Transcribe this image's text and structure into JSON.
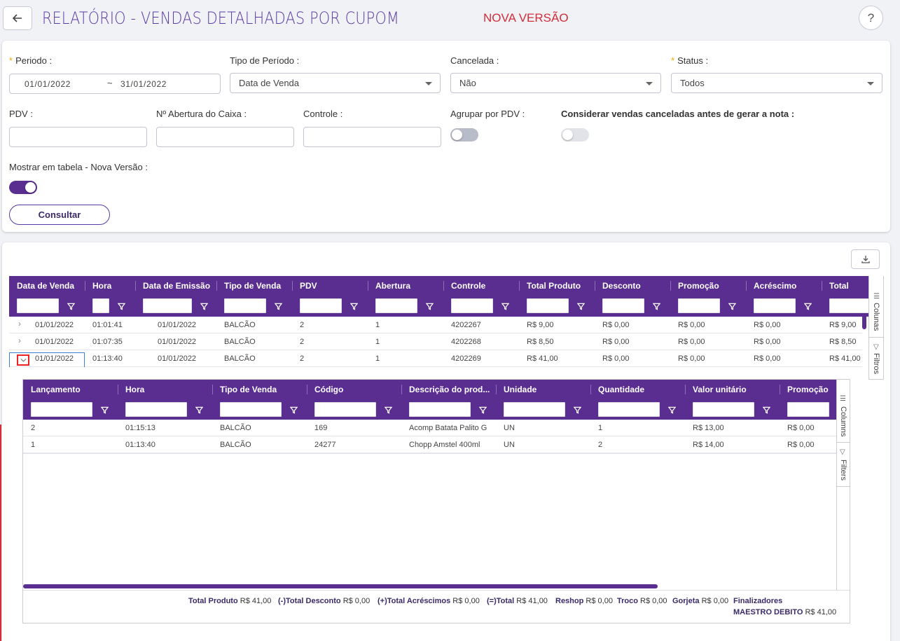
{
  "header": {
    "title": "RELATÓRIO - VENDAS DETALHADAS POR CUPOM",
    "badge": "NOVA VERSÃO",
    "help": "?"
  },
  "filters": {
    "periodo_label": "Periodo",
    "periodo_start": "01/01/2022",
    "periodo_sep": "~",
    "periodo_end": "31/01/2022",
    "tipo_periodo_label": "Tipo de Período",
    "tipo_periodo_value": "Data de Venda",
    "cancelada_label": "Cancelada",
    "cancelada_value": "Não",
    "status_label": "Status",
    "status_value": "Todos",
    "pdv_label": "PDV",
    "abertura_label": "Nº Abertura do Caixa",
    "controle_label": "Controle",
    "agrupar_label": "Agrupar por PDV",
    "considerar_label": "Considerar vendas canceladas antes de gerar a nota",
    "mostrar_label": "Mostrar em tabela - Nova Versão",
    "colon": ":",
    "consultar": "Consultar",
    "agrupar_on": false,
    "considerar_on": false,
    "mostrar_on": true
  },
  "main_grid": {
    "columns": [
      "Data de Venda",
      "Hora",
      "Data de Emissão",
      "Tipo de Venda",
      "PDV",
      "Abertura",
      "Controle",
      "Total Produto",
      "Desconto",
      "Promoção",
      "Acréscimo",
      "Total"
    ],
    "rows": [
      [
        "01/01/2022",
        "01:01:41",
        "01/01/2022",
        "BALCÃO",
        "2",
        "1",
        "4202267",
        "R$ 9,00",
        "R$ 0,00",
        "R$ 0,00",
        "R$ 0,00",
        "R$ 9,00"
      ],
      [
        "01/01/2022",
        "01:07:35",
        "01/01/2022",
        "BALCÃO",
        "2",
        "1",
        "4202268",
        "R$ 8,50",
        "R$ 0,00",
        "R$ 0,00",
        "R$ 0,00",
        "R$ 8,50"
      ],
      [
        "01/01/2022",
        "01:13:40",
        "01/01/2022",
        "BALCÃO",
        "2",
        "1",
        "4202269",
        "R$ 41,00",
        "R$ 0,00",
        "R$ 0,00",
        "R$ 0,00",
        "R$ 41,00"
      ]
    ],
    "side_columns": "Colunas",
    "side_filters": "Filtros"
  },
  "detail_grid": {
    "columns": [
      "Lançamento",
      "Hora",
      "Tipo de Venda",
      "Código",
      "Descrição do prod...",
      "Unidade",
      "Quantidade",
      "Valor unitário",
      "Promoção"
    ],
    "rows": [
      [
        "2",
        "01:15:13",
        "BALCÃO",
        "169",
        "Acomp Batata Palito G",
        "UN",
        "1",
        "R$ 13,00",
        "R$ 0,00"
      ],
      [
        "1",
        "01:13:40",
        "BALCÃO",
        "24277",
        "Chopp Amstel 400ml",
        "UN",
        "2",
        "R$ 14,00",
        "R$ 0,00"
      ]
    ],
    "side_columns": "Columns",
    "side_filters": "Filters"
  },
  "totals": {
    "total_produto_label": "Total Produto",
    "total_produto": "R$ 41,00",
    "total_desconto_label": "(-)Total Desconto",
    "total_desconto": "R$ 0,00",
    "total_acrescimos_label": "(+)Total Acréscimos",
    "total_acrescimos": "R$ 0,00",
    "total_label": "(=)Total",
    "total": "R$ 41,00",
    "reshop_label": "Reshop",
    "reshop": "R$ 0,00",
    "troco_label": "Troco",
    "troco": "R$ 0,00",
    "gorjeta_label": "Gorjeta",
    "gorjeta": "R$ 0,00",
    "finalizadores_label": "Finalizadores",
    "maestro_label": "MAESTRO DEBITO",
    "maestro": "R$ 41,00"
  },
  "colors": {
    "accent": "#5a2d91",
    "title": "#5a3aa6",
    "badge": "#d22d3a",
    "required": "#f2a900"
  }
}
